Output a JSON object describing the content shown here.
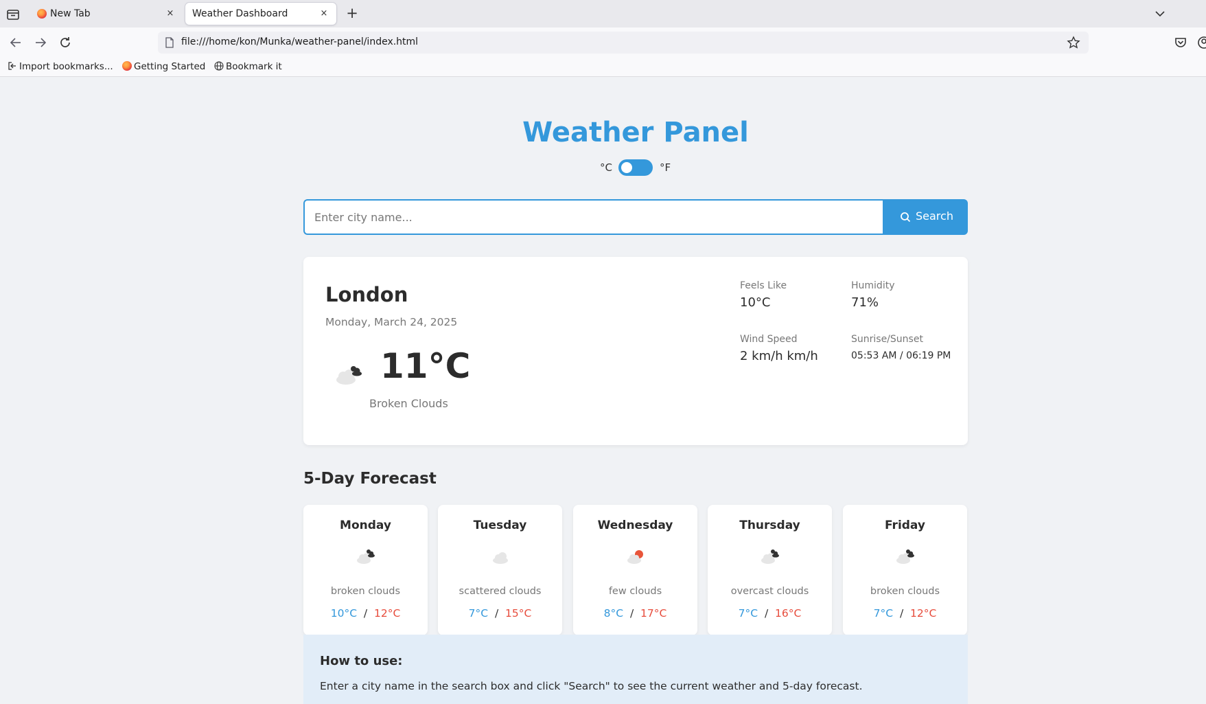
{
  "browser": {
    "tabs": [
      {
        "label": "New Tab",
        "close": "×"
      },
      {
        "label": "Weather Dashboard",
        "close": "×"
      }
    ],
    "new_tab": "+",
    "url": "file:///home/kon/Munka/weather-panel/index.html",
    "bookmarks": [
      "Import bookmarks...",
      "Getting Started",
      "Bookmark it"
    ]
  },
  "app": {
    "title": "Weather Panel",
    "unit_c": "°C",
    "unit_f": "°F",
    "search": {
      "placeholder": "Enter city name...",
      "button": "Search"
    }
  },
  "current": {
    "city": "London",
    "date": "Monday, March 24, 2025",
    "temp": "11°C",
    "description": "Broken Clouds",
    "icon": "broken-clouds-icon",
    "details": {
      "feels_like_label": "Feels Like",
      "feels_like": "10°C",
      "humidity_label": "Humidity",
      "humidity": "71%",
      "wind_label": "Wind Speed",
      "wind": "2 km/h km/h",
      "sun_label": "Sunrise/Sunset",
      "sun": "05:53 AM / 06:19 PM"
    }
  },
  "forecast": {
    "title": "5-Day Forecast",
    "separator": "/",
    "days": [
      {
        "day": "Monday",
        "icon": "broken-clouds-icon",
        "desc": "broken clouds",
        "low": "10°C",
        "high": "12°C"
      },
      {
        "day": "Tuesday",
        "icon": "scattered-clouds-icon",
        "desc": "scattered clouds",
        "low": "7°C",
        "high": "15°C"
      },
      {
        "day": "Wednesday",
        "icon": "few-clouds-icon",
        "desc": "few clouds",
        "low": "8°C",
        "high": "17°C"
      },
      {
        "day": "Thursday",
        "icon": "overcast-clouds-icon",
        "desc": "overcast clouds",
        "low": "7°C",
        "high": "16°C"
      },
      {
        "day": "Friday",
        "icon": "broken-clouds-icon",
        "desc": "broken clouds",
        "low": "7°C",
        "high": "12°C"
      }
    ]
  },
  "howto": {
    "title": "How to use:",
    "text": "Enter a city name in the search box and click \"Search\" to see the current weather and 5-day forecast."
  },
  "colors": {
    "accent": "#3498db",
    "low": "#3498db",
    "high": "#e74c3c",
    "sun": "#e8553a"
  }
}
